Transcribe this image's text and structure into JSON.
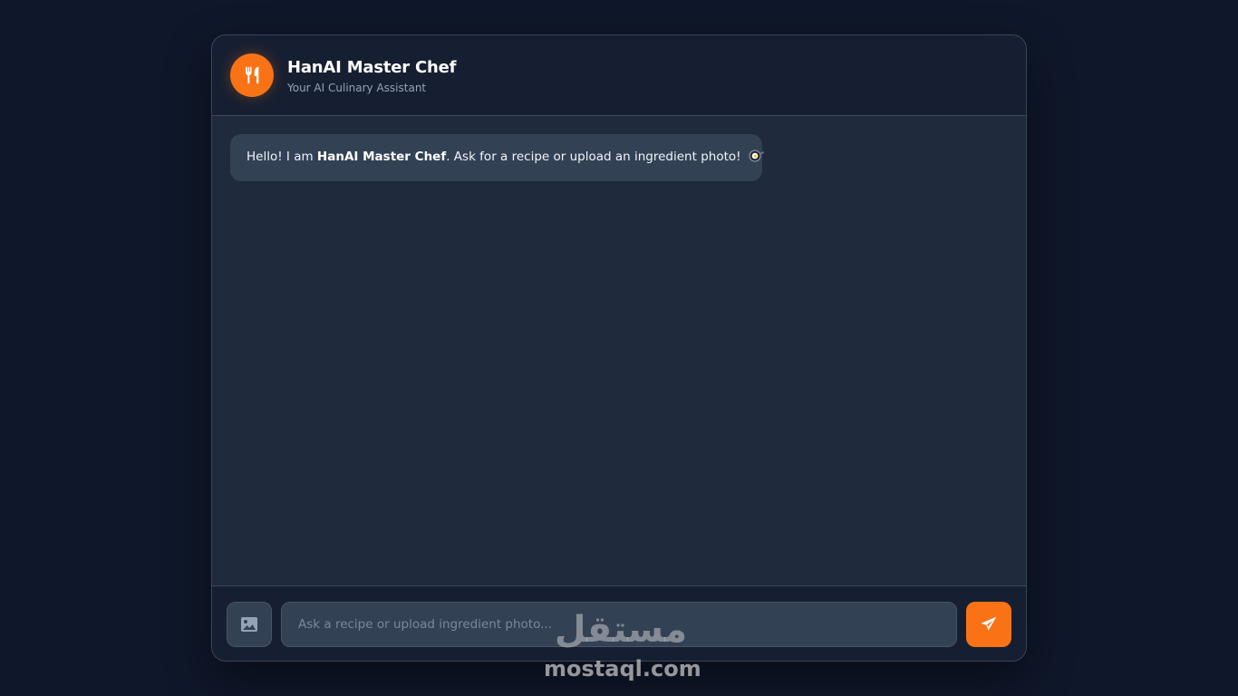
{
  "header": {
    "title": "HanAI Master Chef",
    "subtitle": "Your AI Culinary Assistant",
    "avatar_icon": "utensils-icon"
  },
  "messages": [
    {
      "sender": "bot",
      "text_before": "Hello! I am ",
      "bold": "HanAI Master Chef",
      "text_after": ". Ask for a recipe or upload an ingredient photo!",
      "emoji": "frying-pan-icon"
    }
  ],
  "composer": {
    "upload_icon": "image-icon",
    "placeholder": "Ask a recipe or upload ingredient photo...",
    "send_icon": "paper-plane-icon"
  },
  "watermark": {
    "arabic": "مستقل",
    "latin": "mostaql.com"
  },
  "colors": {
    "page_bg": "#0f172a",
    "panel_bg": "#1e293b",
    "accent": "#f97316",
    "bubble_bg": "#334155"
  }
}
